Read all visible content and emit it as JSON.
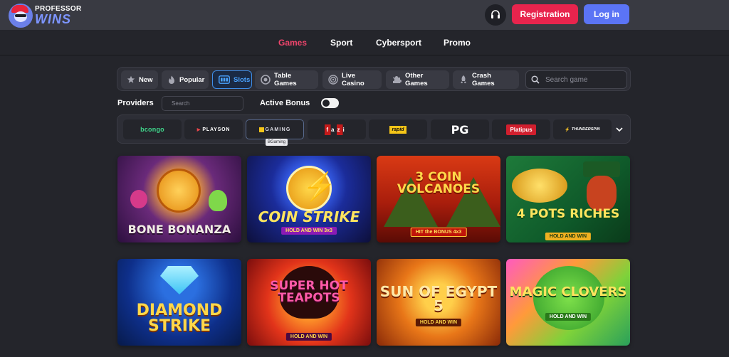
{
  "brand": {
    "line1": "PROFESSOR",
    "line2": "WINS"
  },
  "header": {
    "registration_label": "Registration",
    "login_label": "Log in",
    "support_icon": "headset-icon"
  },
  "nav": {
    "items": [
      "Games",
      "Sport",
      "Cybersport",
      "Promo"
    ],
    "active": "Games"
  },
  "filters": {
    "chips": [
      {
        "label": "New",
        "icon": "star-icon"
      },
      {
        "label": "Popular",
        "icon": "flame-icon"
      },
      {
        "label": "Slots",
        "icon": "slot-machine-icon",
        "active": true
      },
      {
        "label": "Table Games",
        "icon": "cards-icon"
      },
      {
        "label": "Live Casino",
        "icon": "roulette-icon"
      },
      {
        "label": "Other Games",
        "icon": "puzzle-icon"
      },
      {
        "label": "Crash Games",
        "icon": "rocket-icon"
      }
    ],
    "search_placeholder": "Search game"
  },
  "providers": {
    "label": "Providers",
    "search_placeholder": "Search",
    "active_bonus_label": "Active Bonus",
    "active_bonus_on": false,
    "items": [
      "bcongo",
      "PLAYSON",
      "GAMING",
      "fazi",
      "rapid",
      "PG",
      "Platipus",
      "THUNDERSPIN"
    ],
    "selected": "GAMING",
    "tooltip": "BGaming"
  },
  "games": [
    {
      "title": "BONE BONANZA",
      "sub": ""
    },
    {
      "title": "COIN STRIKE",
      "sub": "HOLD AND WIN 3x3"
    },
    {
      "title": "3 COIN VOLCANOES",
      "sub": "HIT the BONUS 4x3"
    },
    {
      "title": "4 POTS RICHES",
      "sub": "HOLD AND WIN"
    },
    {
      "title": "DIAMOND STRIKE",
      "sub": ""
    },
    {
      "title": "SUPER HOT TEAPOTS",
      "sub": "HOLD AND WIN"
    },
    {
      "title": "SUN OF EGYPT 5",
      "sub": "HOLD AND WIN"
    },
    {
      "title": "MAGIC CLOVERS",
      "sub": "HOLD AND WIN"
    }
  ],
  "colors": {
    "accent_pink": "#e8244d",
    "accent_blue": "#5b74f5",
    "active_nav": "#f0456c",
    "active_chip": "#3f8ee8"
  }
}
